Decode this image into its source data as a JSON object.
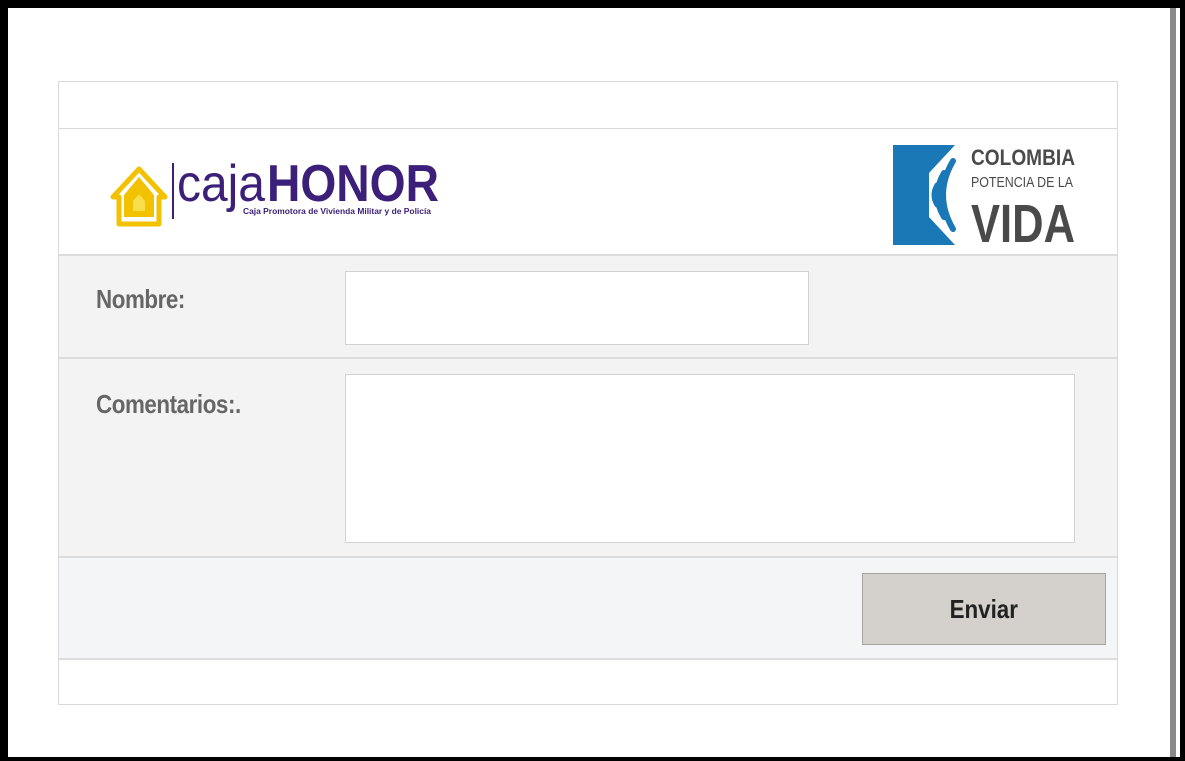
{
  "header": {
    "cajahonor": {
      "word_light": "caja",
      "word_bold": "HONOR",
      "tagline": "Caja Promotora de Vivienda Militar y de Policía"
    },
    "colombia": {
      "line1": "COLOMBIA",
      "line2": "POTENCIA DE LA",
      "line3": "VIDA"
    }
  },
  "form": {
    "nombre_label": "Nombre:",
    "nombre_value": "",
    "comentarios_label": "Comentarios:.",
    "comentarios_value": "",
    "submit_label": "Enviar"
  },
  "colors": {
    "brand_purple": "#3b1f78",
    "brand_yellow": "#f2c200",
    "colombia_blue": "#1a78b6",
    "colombia_gray": "#4a4a4a"
  }
}
